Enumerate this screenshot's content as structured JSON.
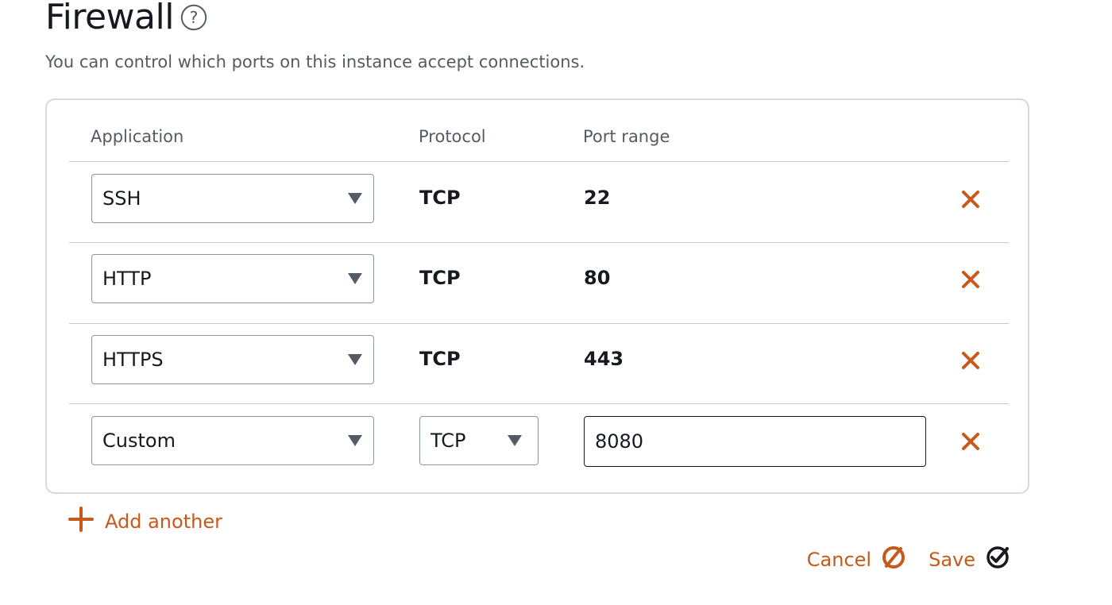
{
  "header": {
    "title": "Firewall",
    "help_icon": "question-circle-icon",
    "subtitle": "You can control which ports on this instance accept connections."
  },
  "table": {
    "columns": [
      "Application",
      "Protocol",
      "Port range"
    ],
    "rows": [
      {
        "application": "SSH",
        "protocol": "TCP",
        "port_range": "22",
        "editable": false
      },
      {
        "application": "HTTP",
        "protocol": "TCP",
        "port_range": "80",
        "editable": false
      },
      {
        "application": "HTTPS",
        "protocol": "TCP",
        "port_range": "443",
        "editable": false
      },
      {
        "application": "Custom",
        "protocol": "TCP",
        "port_range": "8080",
        "editable": true
      }
    ],
    "remove_icon": "close-icon",
    "dropdown_icon": "triangle-down-icon"
  },
  "add_another": {
    "label": "Add another",
    "icon": "plus-icon"
  },
  "actions": {
    "cancel_label": "Cancel",
    "cancel_icon": "cancel-circle-icon",
    "save_label": "Save",
    "save_icon": "check-circle-icon"
  },
  "colors": {
    "accent": "#c7591a",
    "text": "#16191f",
    "muted": "#545b64",
    "border": "#d5dbdb"
  }
}
